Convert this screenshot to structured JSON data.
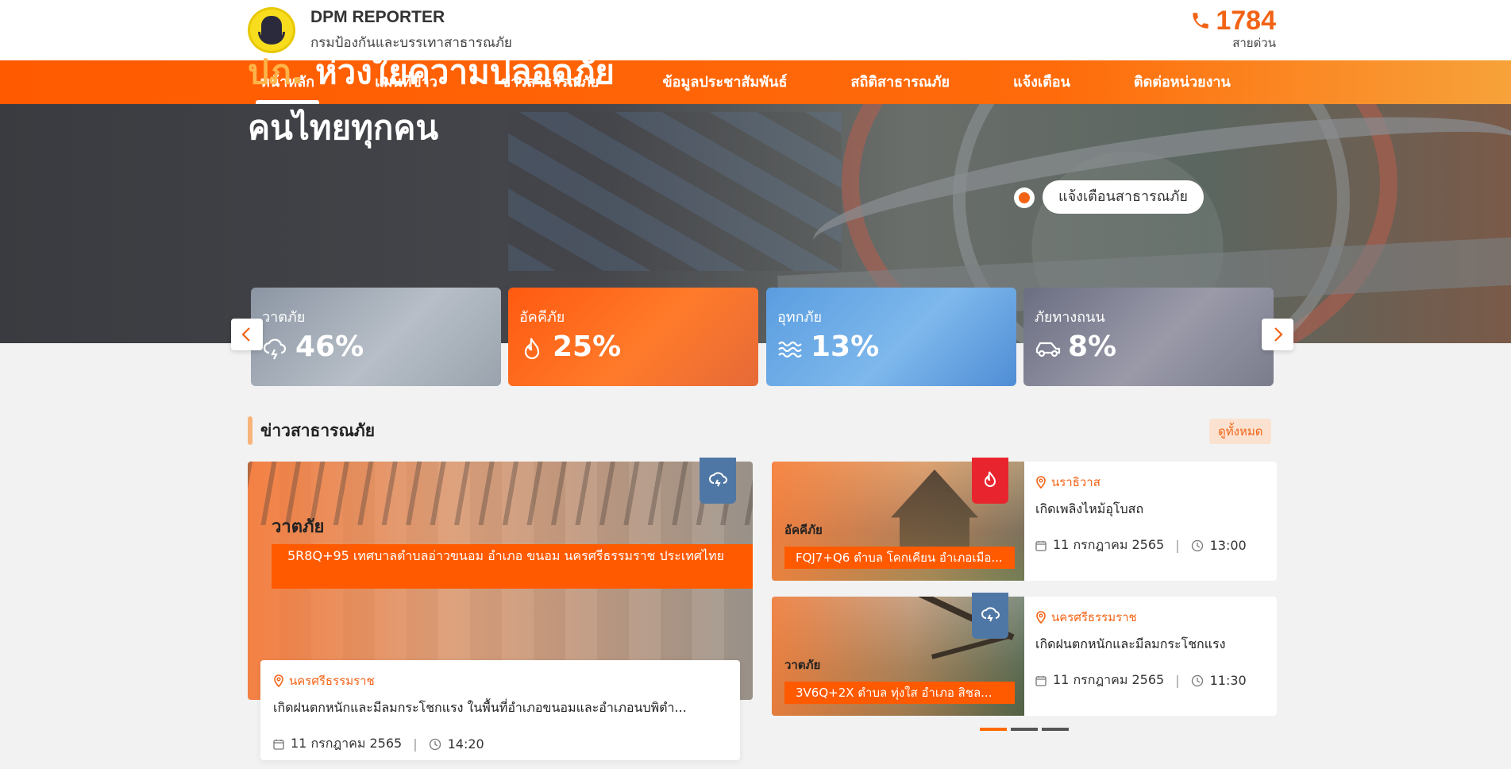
{
  "header": {
    "brand_title": "DPM REPORTER",
    "brand_subtitle": "กรมป้องกันและบรรเทาสาธารณภัย",
    "hotline_number": "1784",
    "hotline_label": "สายด่วน"
  },
  "nav": {
    "items": [
      {
        "label": "หน้าหลัก",
        "active": true
      },
      {
        "label": "แผนที่ข่าว"
      },
      {
        "label": "ข่าวสาธารณภัย"
      },
      {
        "label": "ข้อมูลประชาสัมพันธ์"
      },
      {
        "label": "สถิติสาธารณภัย"
      },
      {
        "label": "แจ้งเตือน"
      },
      {
        "label": "ติดต่อหน่วยงาน"
      }
    ]
  },
  "hero": {
    "title_accent": "ปภ.",
    "title_line1": "ห่วงใยความปลอดภัย",
    "title_line2": "คนไทยทุกคน",
    "alert_button": "แจ้งเตือนสาธารณภัย"
  },
  "stats": [
    {
      "label": "วาตภัย",
      "value": "46%",
      "icon": "storm-cloud-icon"
    },
    {
      "label": "อัคคีภัย",
      "value": "25%",
      "icon": "fire-icon"
    },
    {
      "label": "อุทกภัย",
      "value": "13%",
      "icon": "wave-icon"
    },
    {
      "label": "ภัยทางถนน",
      "value": "8%",
      "icon": "car-icon"
    }
  ],
  "news": {
    "section_title": "ข่าวสาธารณภัย",
    "see_all": "ดูทั้งหมด",
    "featured": {
      "category": "วาตภัย",
      "address": "5R8Q+95 เทศบาลตำบลอ่าวขนอม อำเภอ ขนอม นครศรีธรรมราช ประเทศไทย",
      "province": "นครศรีธรรมราช",
      "description": "เกิดฝนตกหนักและมีลมกระโชกแรง ในพื้นที่อำเภอขนอมและอำเภอนบพิตำ...",
      "date": "11 กรกฎาคม 2565",
      "time": "14:20",
      "tag_color": "#4f77a5"
    },
    "items": [
      {
        "category": "อัคคีภัย",
        "address": "FQJ7+Q6 ตำบล โคกเคียน อำเภอเมือ...",
        "province": "นราธิวาส",
        "description": "เกิดเพลิงไหม้อุโบสถ",
        "date": "11 กรกฎาคม 2565",
        "time": "13:00",
        "tag_color": "#e8252e"
      },
      {
        "category": "วาตภัย",
        "address": "3V6Q+2X ตำบล ทุ่งใส อำเภอ สิชล...",
        "province": "นครศรีธรรมราช",
        "description": "เกิดฝนตกหนักและมีลมกระโชกแรง",
        "date": "11 กรกฎาคม 2565",
        "time": "11:30",
        "tag_color": "#4f77a5"
      }
    ]
  },
  "colors": {
    "accent": "#ff5a00",
    "accent_text": "#f26315",
    "hero_accent": "#ffb44a"
  }
}
